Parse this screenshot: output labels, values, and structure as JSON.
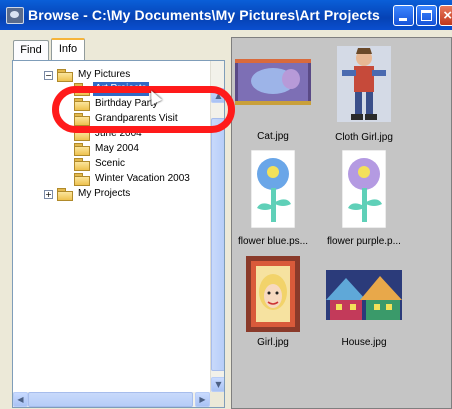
{
  "window": {
    "title": "Browse - C:\\My Documents\\My Pictures\\Art Projects",
    "min_label": "_",
    "close_label": "×"
  },
  "tabs": [
    {
      "label": "Find"
    },
    {
      "label": "Info"
    }
  ],
  "tree": {
    "items": [
      {
        "label": "My Pictures",
        "expander": "−"
      },
      {
        "label": "Art Projects",
        "selected": true
      },
      {
        "label": "Birthday Party"
      },
      {
        "label": "Grandparents Visit"
      },
      {
        "label": "June 2004"
      },
      {
        "label": "May 2004"
      },
      {
        "label": "Scenic"
      },
      {
        "label": "Winter Vacation 2003"
      },
      {
        "label": "My Projects",
        "expander": "+"
      }
    ],
    "scroll_up": "▲",
    "scroll_down": "▼",
    "scroll_left": "◀",
    "scroll_right": "▶"
  },
  "thumbnails": [
    {
      "caption": "Cat.jpg"
    },
    {
      "caption": "Cloth Girl.jpg"
    },
    {
      "caption": "flower blue.ps..."
    },
    {
      "caption": "flower purple.p..."
    },
    {
      "caption": "Girl.jpg"
    },
    {
      "caption": "House.jpg"
    }
  ],
  "colors": {
    "titlebar": "#0a4ecf",
    "selection": "#316ac5",
    "annotation_ring": "#ff1a1a",
    "right_pane_bg": "#c5c5c5"
  }
}
